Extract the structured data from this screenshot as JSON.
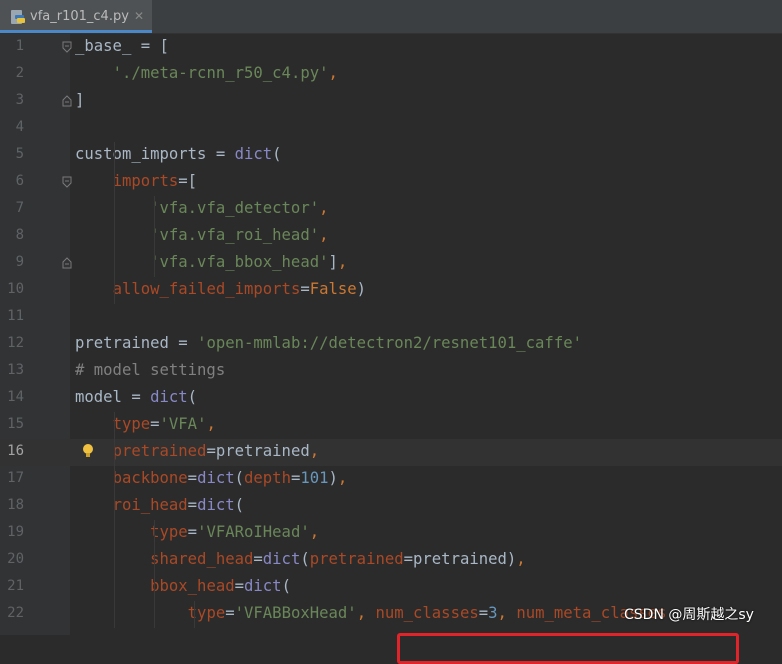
{
  "tab": {
    "filename": "vfa_r101_c4.py",
    "close_glyph": "✕",
    "icon": "python-file-icon"
  },
  "lines": [
    {
      "num": "1",
      "tokens": [
        [
          "",
          "_base_ = ["
        ]
      ]
    },
    {
      "num": "2",
      "tokens": [
        [
          "",
          "    "
        ],
        [
          "str",
          "'./meta-rcnn_r50_c4.py'"
        ],
        [
          "kw",
          ","
        ]
      ]
    },
    {
      "num": "3",
      "tokens": [
        [
          "",
          "]"
        ]
      ]
    },
    {
      "num": "4",
      "tokens": []
    },
    {
      "num": "5",
      "tokens": [
        [
          "",
          "custom_imports = "
        ],
        [
          "builtin",
          "dict"
        ],
        [
          "",
          "("
        ]
      ]
    },
    {
      "num": "6",
      "tokens": [
        [
          "",
          "    "
        ],
        [
          "param",
          "imports"
        ],
        [
          "",
          "=["
        ]
      ]
    },
    {
      "num": "7",
      "tokens": [
        [
          "",
          "        "
        ],
        [
          "str",
          "'vfa.vfa_detector'"
        ],
        [
          "kw",
          ","
        ]
      ]
    },
    {
      "num": "8",
      "tokens": [
        [
          "",
          "        "
        ],
        [
          "str",
          "'vfa.vfa_roi_head'"
        ],
        [
          "kw",
          ","
        ]
      ]
    },
    {
      "num": "9",
      "tokens": [
        [
          "",
          "        "
        ],
        [
          "str",
          "'vfa.vfa_bbox_head'"
        ],
        [
          "",
          "]"
        ],
        [
          "kw",
          ","
        ]
      ]
    },
    {
      "num": "10",
      "tokens": [
        [
          "",
          "    "
        ],
        [
          "param",
          "allow_failed_imports"
        ],
        [
          "",
          "="
        ],
        [
          "kw",
          "False"
        ],
        [
          "",
          ")"
        ]
      ]
    },
    {
      "num": "11",
      "tokens": []
    },
    {
      "num": "12",
      "tokens": [
        [
          "",
          "pretrained = "
        ],
        [
          "str",
          "'open-mmlab://detectron2/resnet101_caffe'"
        ]
      ]
    },
    {
      "num": "13",
      "tokens": [
        [
          "comment",
          "# model settings"
        ]
      ]
    },
    {
      "num": "14",
      "tokens": [
        [
          "",
          "model = "
        ],
        [
          "builtin",
          "dict"
        ],
        [
          "",
          "("
        ]
      ]
    },
    {
      "num": "15",
      "tokens": [
        [
          "",
          "    "
        ],
        [
          "param",
          "type"
        ],
        [
          "",
          "="
        ],
        [
          "str",
          "'VFA'"
        ],
        [
          "kw",
          ","
        ]
      ]
    },
    {
      "num": "16",
      "tokens": [
        [
          "",
          "    "
        ],
        [
          "param",
          "pretrained"
        ],
        [
          "",
          "=pretrained"
        ],
        [
          "kw",
          ","
        ]
      ]
    },
    {
      "num": "17",
      "tokens": [
        [
          "",
          "    "
        ],
        [
          "param",
          "backbone"
        ],
        [
          "",
          "="
        ],
        [
          "builtin",
          "dict"
        ],
        [
          "",
          "("
        ],
        [
          "param",
          "depth"
        ],
        [
          "",
          "="
        ],
        [
          "num",
          "101"
        ],
        [
          "",
          ")"
        ],
        [
          "kw",
          ","
        ]
      ]
    },
    {
      "num": "18",
      "tokens": [
        [
          "",
          "    "
        ],
        [
          "param",
          "roi_head"
        ],
        [
          "",
          "="
        ],
        [
          "builtin",
          "dict"
        ],
        [
          "",
          "("
        ]
      ]
    },
    {
      "num": "19",
      "tokens": [
        [
          "",
          "        "
        ],
        [
          "param",
          "type"
        ],
        [
          "",
          "="
        ],
        [
          "str",
          "'VFARoIHead'"
        ],
        [
          "kw",
          ","
        ]
      ]
    },
    {
      "num": "20",
      "tokens": [
        [
          "",
          "        "
        ],
        [
          "param",
          "shared_head"
        ],
        [
          "",
          "="
        ],
        [
          "builtin",
          "dict"
        ],
        [
          "",
          "("
        ],
        [
          "param",
          "pretrained"
        ],
        [
          "",
          "=pretrained)"
        ],
        [
          "kw",
          ","
        ]
      ]
    },
    {
      "num": "21",
      "tokens": [
        [
          "",
          "        "
        ],
        [
          "param",
          "bbox_head"
        ],
        [
          "",
          "="
        ],
        [
          "builtin",
          "dict"
        ],
        [
          "",
          "("
        ]
      ]
    },
    {
      "num": "22",
      "tokens": [
        [
          "",
          "            "
        ],
        [
          "param",
          "type"
        ],
        [
          "",
          "="
        ],
        [
          "str",
          "'VFABBoxHead'"
        ],
        [
          "kw",
          ", "
        ],
        [
          "param",
          "num_classes"
        ],
        [
          "",
          "="
        ],
        [
          "num",
          "3"
        ],
        [
          "kw",
          ", "
        ],
        [
          "param",
          "num_meta_classes"
        ]
      ]
    }
  ],
  "current_line": "16",
  "watermark": "CSDN @周斯越之sy",
  "colors": {
    "background": "#2b2b2b",
    "gutter": "#313335",
    "highlight_box": "#e0242a"
  }
}
